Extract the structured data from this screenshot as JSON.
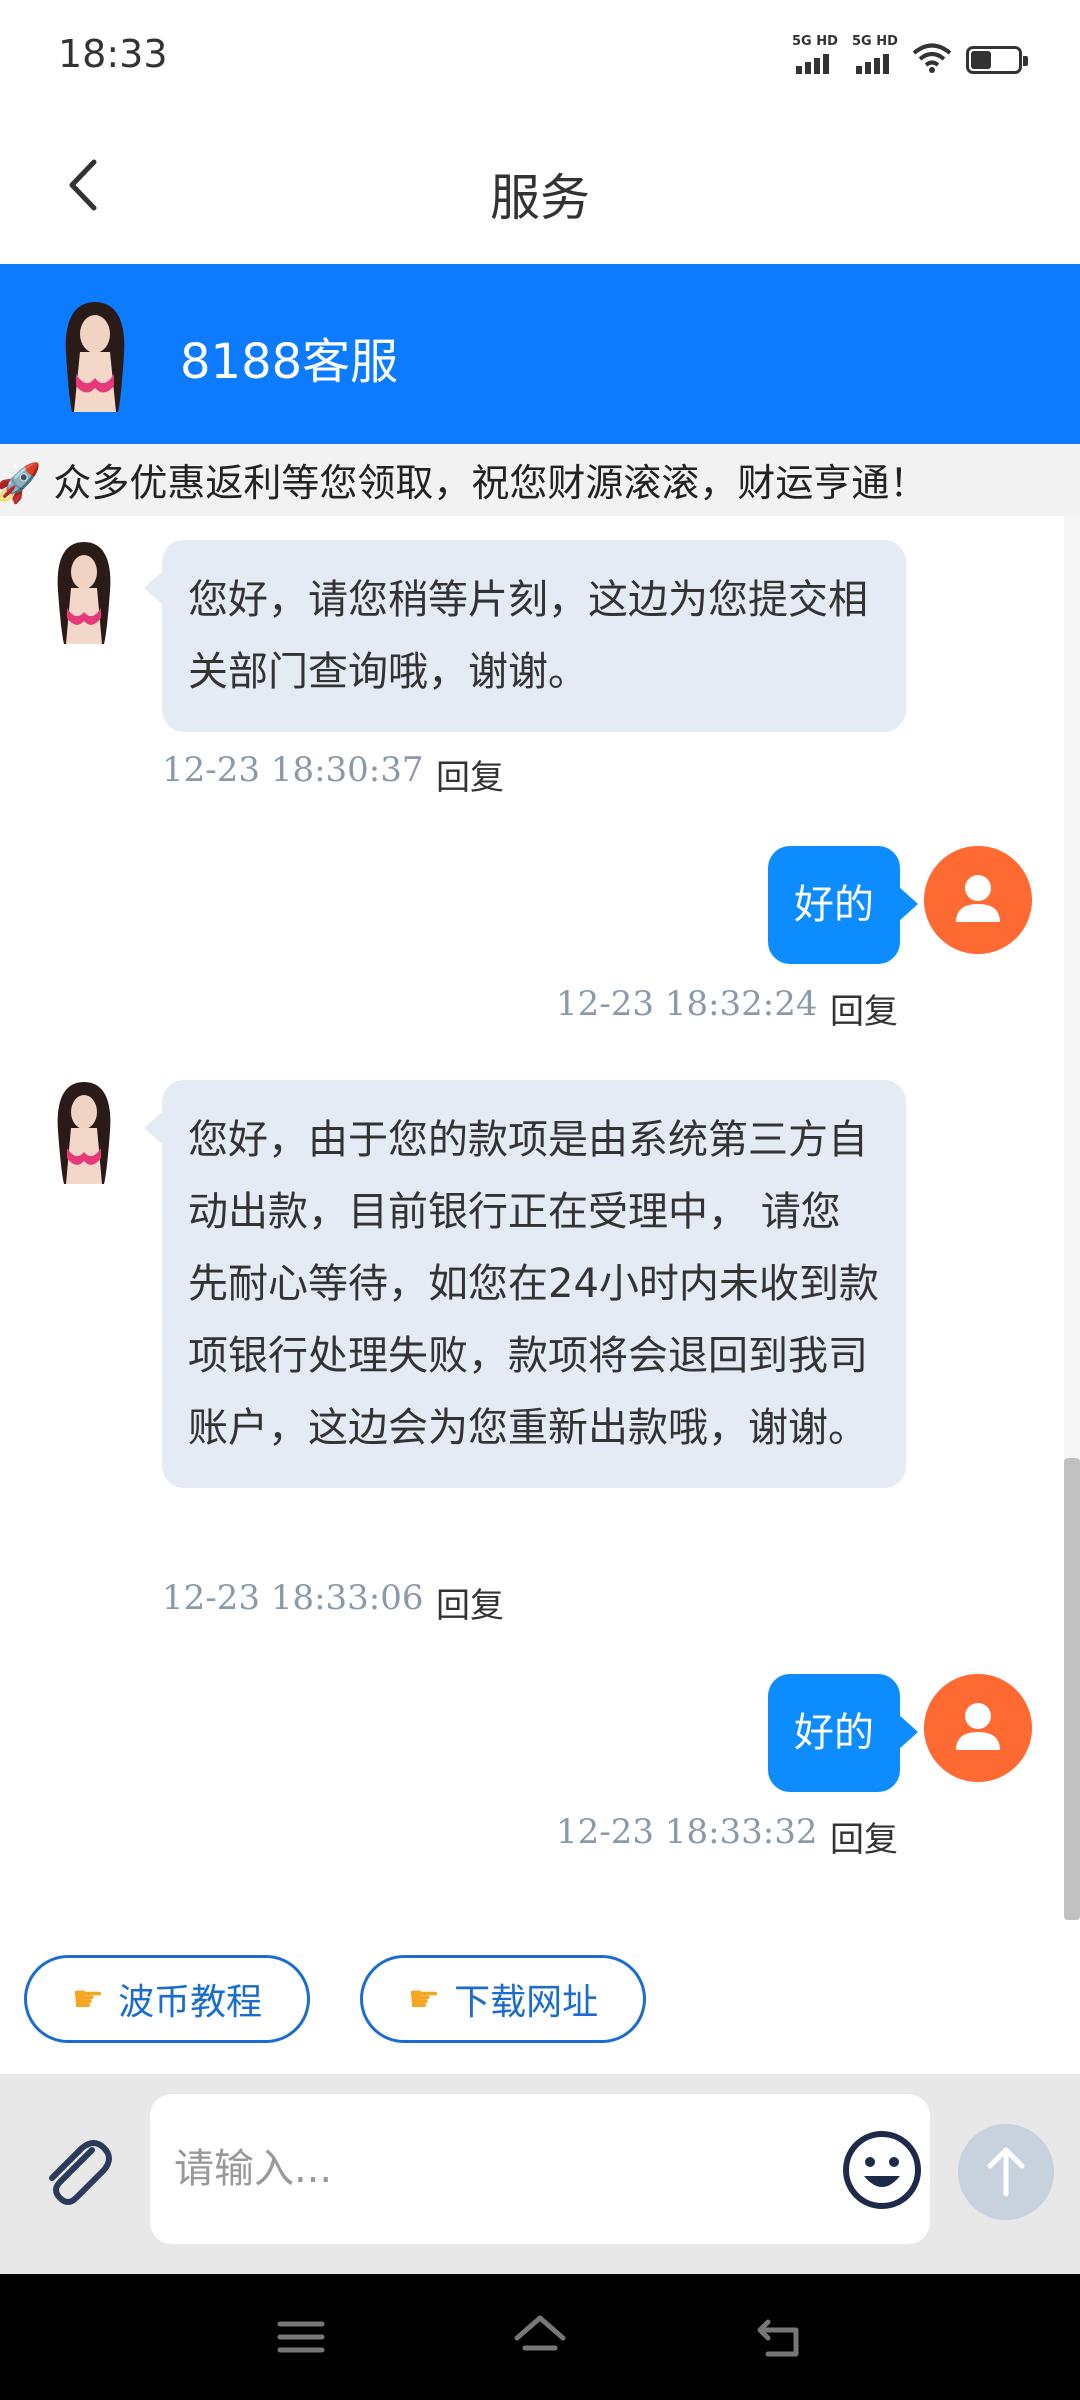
{
  "status_bar": {
    "time": "18:33",
    "sim1_label": "5G HD",
    "sim2_label": "5G HD"
  },
  "nav": {
    "title": "服务",
    "back_icon": "chevron-left-icon"
  },
  "service": {
    "name": "8188客服",
    "header_color": "#0c7bff"
  },
  "notice": {
    "icon": "rocket-icon",
    "text": "🚀 众多优惠返利等您领取，祝您财源滚滚，财运亨通！"
  },
  "messages": [
    {
      "sender": "agent",
      "text": "您好，请您稍等片刻，这边为您提交相关部门查询哦，谢谢。",
      "time": "12-23 18:30:37",
      "reply_label": "回复"
    },
    {
      "sender": "user",
      "text": "好的",
      "time": "12-23 18:32:24",
      "reply_label": "回复"
    },
    {
      "sender": "agent",
      "text": "您好，由于您的款项是由系统第三方自动出款，目前银行正在受理中， 请您先耐心等待，如您在24小时内未收到款项银行处理失败，款项将会退回到我司账户，这边会为您重新出款哦，谢谢。",
      "time": "12-23 18:33:06",
      "reply_label": "回复"
    },
    {
      "sender": "user",
      "text": "好的",
      "time": "12-23 18:33:32",
      "reply_label": "回复"
    }
  ],
  "quick_actions": [
    {
      "icon": "pointing-hand-icon",
      "label": "波币教程"
    },
    {
      "icon": "pointing-hand-icon",
      "label": "下载网址"
    }
  ],
  "input": {
    "placeholder": "请输入...",
    "attach_icon": "paperclip-icon",
    "emoji_icon": "smiley-icon",
    "send_icon": "arrow-up-icon"
  },
  "colors": {
    "accent": "#0c8cff",
    "user_avatar": "#ff6a32",
    "agent_bubble": "#e5ebf4"
  }
}
